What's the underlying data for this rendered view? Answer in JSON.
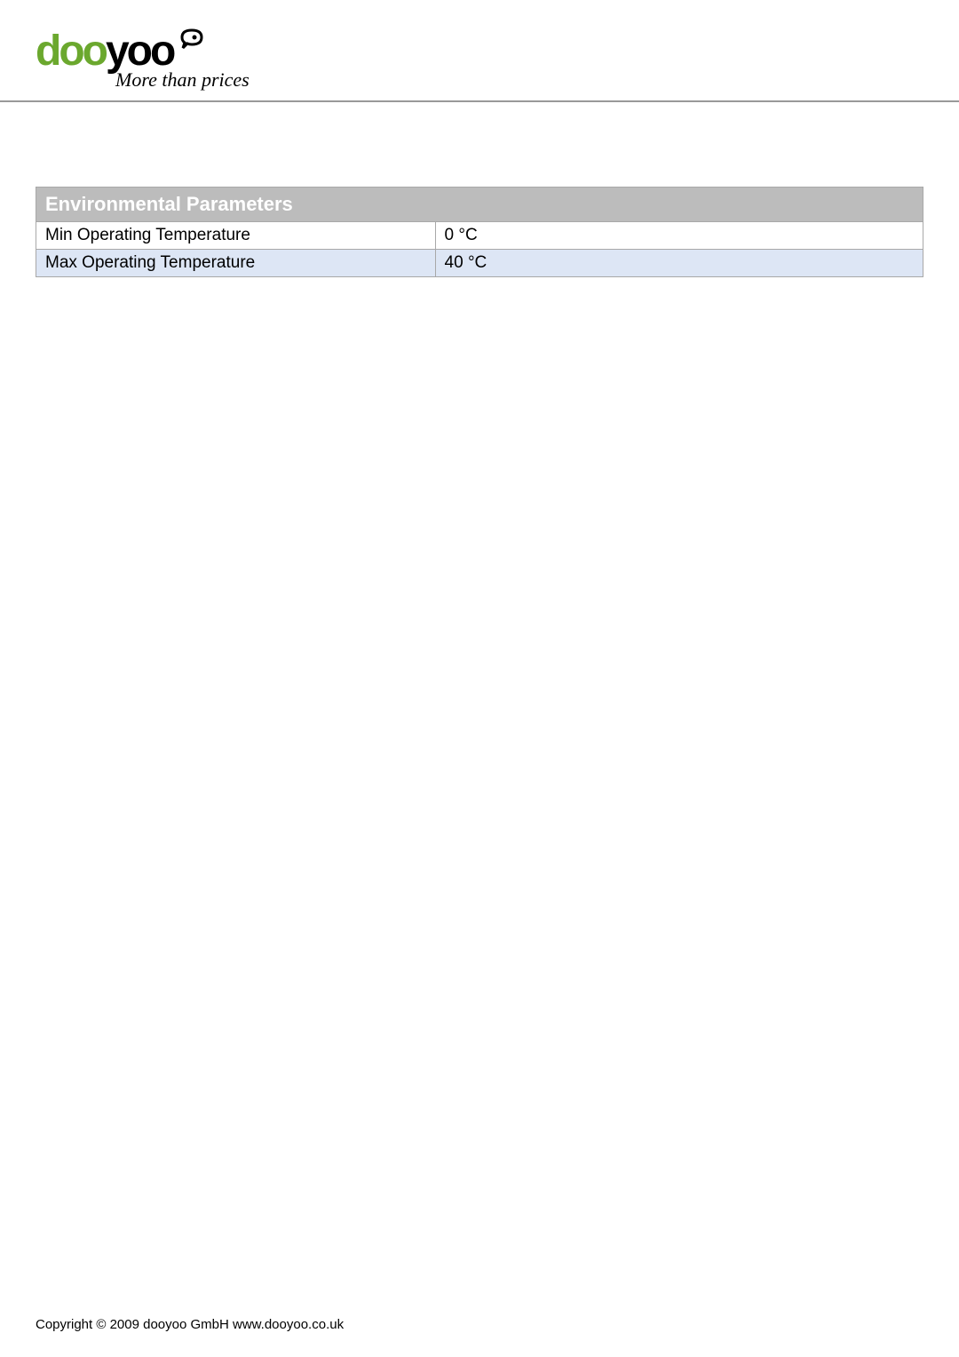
{
  "header": {
    "logo_text_1": "doo",
    "logo_text_2": "yoo",
    "tagline": "More than prices"
  },
  "table": {
    "title": "Environmental Parameters",
    "rows": [
      {
        "label": "Min Operating Temperature",
        "value": "0 °C"
      },
      {
        "label": "Max Operating Temperature",
        "value": "40 °C"
      }
    ]
  },
  "footer": {
    "text": "Copyright  ©  2009 dooyoo GmbH www.dooyoo.co.uk"
  }
}
